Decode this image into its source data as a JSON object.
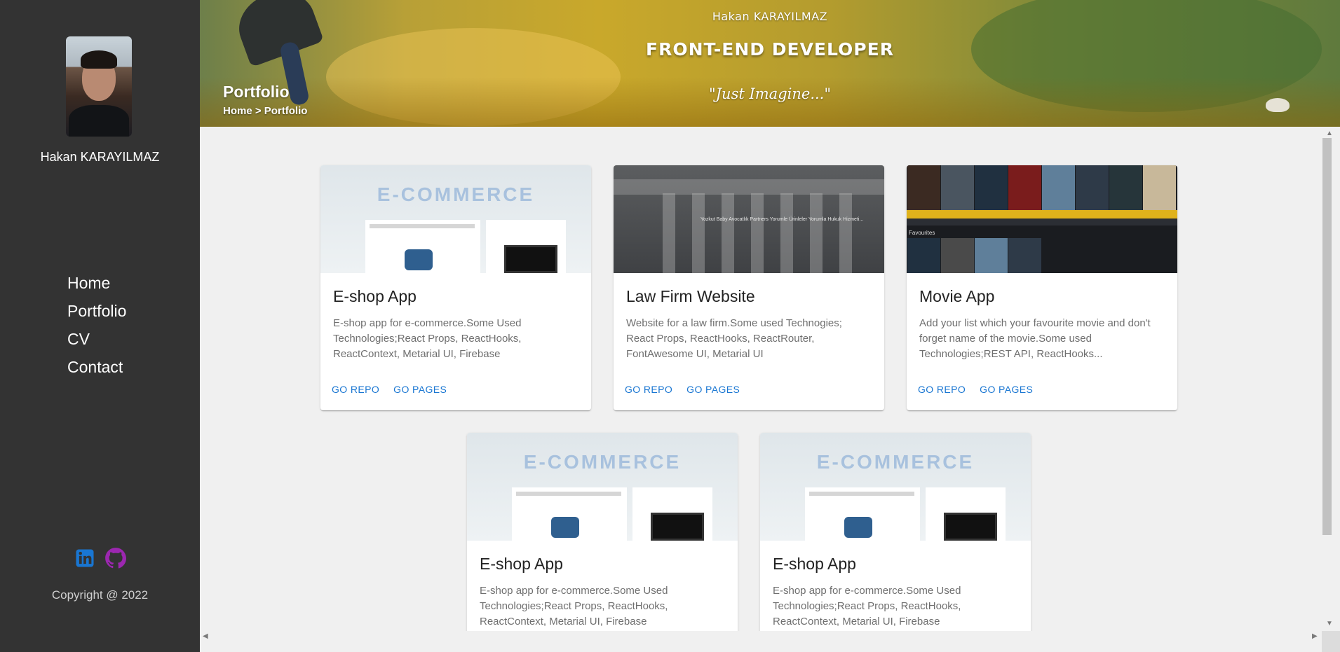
{
  "sidebar": {
    "name": "Hakan KARAYILMAZ",
    "nav": [
      "Home",
      "Portfolio",
      "CV",
      "Contact"
    ],
    "social": [
      {
        "icon": "linkedin-icon",
        "color": "#1976d2"
      },
      {
        "icon": "github-icon",
        "color": "#9c27b0"
      }
    ],
    "copyright": "Copyright @ 2022"
  },
  "header": {
    "name": "Hakan KARAYILMAZ",
    "role": "FRONT-END DEVELOPER",
    "quote": "\"Just Imagine...\"",
    "page_title": "Portfolio",
    "breadcrumb": "Home > Portfolio"
  },
  "projects": [
    {
      "title": "E-shop App",
      "description": "E-shop app for e-commerce.Some Used Technologies;React Props, ReactHooks, ReactContext, Metarial UI, Firebase",
      "media_label": "E-COMMERCE",
      "repo": "GO REPO",
      "pages": "GO PAGES"
    },
    {
      "title": "Law Firm Website",
      "description": "Website for a law firm.Some used Technogies; React Props, ReactHooks, ReactRouter, FontAwesome UI, Metarial UI",
      "media_caption": "Yozkut Baby Avocatlık Partners Yorumle Ürinleler Yorumla Hukuk Hizmeti...",
      "repo": "GO REPO",
      "pages": "GO PAGES"
    },
    {
      "title": "Movie App",
      "description": "Add your list which your favourite movie and don't forget name of the movie.Some used Technologies;REST API, ReactHooks...",
      "media_label": "Favourites",
      "repo": "GO REPO",
      "pages": "GO PAGES"
    },
    {
      "title": "E-shop App",
      "description": "E-shop app for e-commerce.Some Used Technologies;React Props, ReactHooks, ReactContext, Metarial UI, Firebase",
      "media_label": "E-COMMERCE"
    },
    {
      "title": "E-shop App",
      "description": "E-shop app for e-commerce.Some Used Technologies;React Props, ReactHooks, ReactContext, Metarial UI, Firebase",
      "media_label": "E-COMMERCE"
    }
  ],
  "colors": {
    "sidebar_bg": "#333333",
    "link": "#1976d2",
    "content_bg": "#f0f0f0"
  }
}
